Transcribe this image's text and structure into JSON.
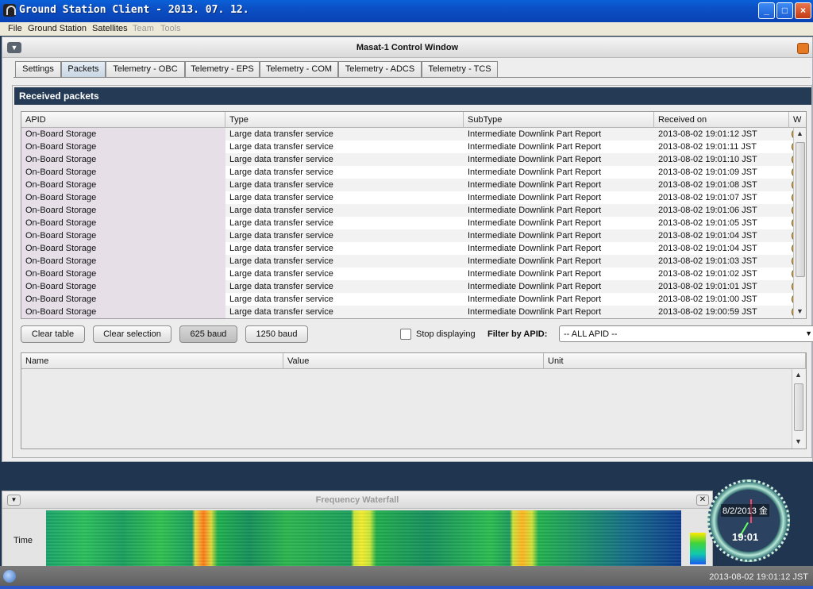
{
  "window": {
    "title": "Ground Station Client - 2013. 07. 12.",
    "buttons": [
      "minimize",
      "maximize",
      "close"
    ]
  },
  "menubar": {
    "items": [
      {
        "label": "File",
        "enabled": true
      },
      {
        "label": "Ground Station",
        "enabled": true
      },
      {
        "label": "Satellites",
        "enabled": true
      },
      {
        "label": "Team",
        "enabled": false
      },
      {
        "label": "Tools",
        "enabled": false
      }
    ]
  },
  "control_window": {
    "title": "Masat-1 Control Window",
    "tabs": [
      {
        "label": "Settings",
        "active": false
      },
      {
        "label": "Packets",
        "active": true
      },
      {
        "label": "Telemetry - OBC",
        "active": false
      },
      {
        "label": "Telemetry - EPS",
        "active": false
      },
      {
        "label": "Telemetry - COM",
        "active": false
      },
      {
        "label": "Telemetry - ADCS",
        "active": false
      },
      {
        "label": "Telemetry - TCS",
        "active": false
      }
    ],
    "panel_title": "Received packets",
    "packet_table": {
      "columns": [
        "APID",
        "Type",
        "SubType",
        "Received on",
        "W"
      ],
      "rows": [
        {
          "apid": "On-Board Storage",
          "type": "Large data transfer service",
          "subtype": "Intermediate Downlink Part Report",
          "received": "2013-08-02 19:01:12 JST"
        },
        {
          "apid": "On-Board Storage",
          "type": "Large data transfer service",
          "subtype": "Intermediate Downlink Part Report",
          "received": "2013-08-02 19:01:11 JST"
        },
        {
          "apid": "On-Board Storage",
          "type": "Large data transfer service",
          "subtype": "Intermediate Downlink Part Report",
          "received": "2013-08-02 19:01:10 JST"
        },
        {
          "apid": "On-Board Storage",
          "type": "Large data transfer service",
          "subtype": "Intermediate Downlink Part Report",
          "received": "2013-08-02 19:01:09 JST"
        },
        {
          "apid": "On-Board Storage",
          "type": "Large data transfer service",
          "subtype": "Intermediate Downlink Part Report",
          "received": "2013-08-02 19:01:08 JST"
        },
        {
          "apid": "On-Board Storage",
          "type": "Large data transfer service",
          "subtype": "Intermediate Downlink Part Report",
          "received": "2013-08-02 19:01:07 JST"
        },
        {
          "apid": "On-Board Storage",
          "type": "Large data transfer service",
          "subtype": "Intermediate Downlink Part Report",
          "received": "2013-08-02 19:01:06 JST"
        },
        {
          "apid": "On-Board Storage",
          "type": "Large data transfer service",
          "subtype": "Intermediate Downlink Part Report",
          "received": "2013-08-02 19:01:05 JST"
        },
        {
          "apid": "On-Board Storage",
          "type": "Large data transfer service",
          "subtype": "Intermediate Downlink Part Report",
          "received": "2013-08-02 19:01:04 JST"
        },
        {
          "apid": "On-Board Storage",
          "type": "Large data transfer service",
          "subtype": "Intermediate Downlink Part Report",
          "received": "2013-08-02 19:01:04 JST"
        },
        {
          "apid": "On-Board Storage",
          "type": "Large data transfer service",
          "subtype": "Intermediate Downlink Part Report",
          "received": "2013-08-02 19:01:03 JST"
        },
        {
          "apid": "On-Board Storage",
          "type": "Large data transfer service",
          "subtype": "Intermediate Downlink Part Report",
          "received": "2013-08-02 19:01:02 JST"
        },
        {
          "apid": "On-Board Storage",
          "type": "Large data transfer service",
          "subtype": "Intermediate Downlink Part Report",
          "received": "2013-08-02 19:01:01 JST"
        },
        {
          "apid": "On-Board Storage",
          "type": "Large data transfer service",
          "subtype": "Intermediate Downlink Part Report",
          "received": "2013-08-02 19:01:00 JST"
        },
        {
          "apid": "On-Board Storage",
          "type": "Large data transfer service",
          "subtype": "Intermediate Downlink Part Report",
          "received": "2013-08-02 19:00:59 JST"
        }
      ]
    },
    "controls": {
      "clear_table": "Clear table",
      "clear_selection": "Clear selection",
      "baud_625": "625 baud",
      "baud_1250": "1250 baud",
      "baud_selected": "625 baud",
      "stop_displaying": "Stop displaying",
      "stop_displaying_checked": false,
      "filter_label": "Filter by APID:",
      "filter_value": "-- ALL APID --"
    },
    "value_table": {
      "columns": [
        "Name",
        "Value",
        "Unit"
      ]
    }
  },
  "waterfall": {
    "title": "Frequency Waterfall",
    "y_label": "Time"
  },
  "clock": {
    "date": "8/2/2013 金",
    "time": "19:01"
  },
  "statusbar": {
    "timestamp": "2013-08-02 19:01:12 JST"
  },
  "colors": {
    "title_bar": "#0a61d8",
    "panel_header": "#253a55",
    "apid_cell": "#e6dfe8",
    "desktop": "#1f3550"
  }
}
